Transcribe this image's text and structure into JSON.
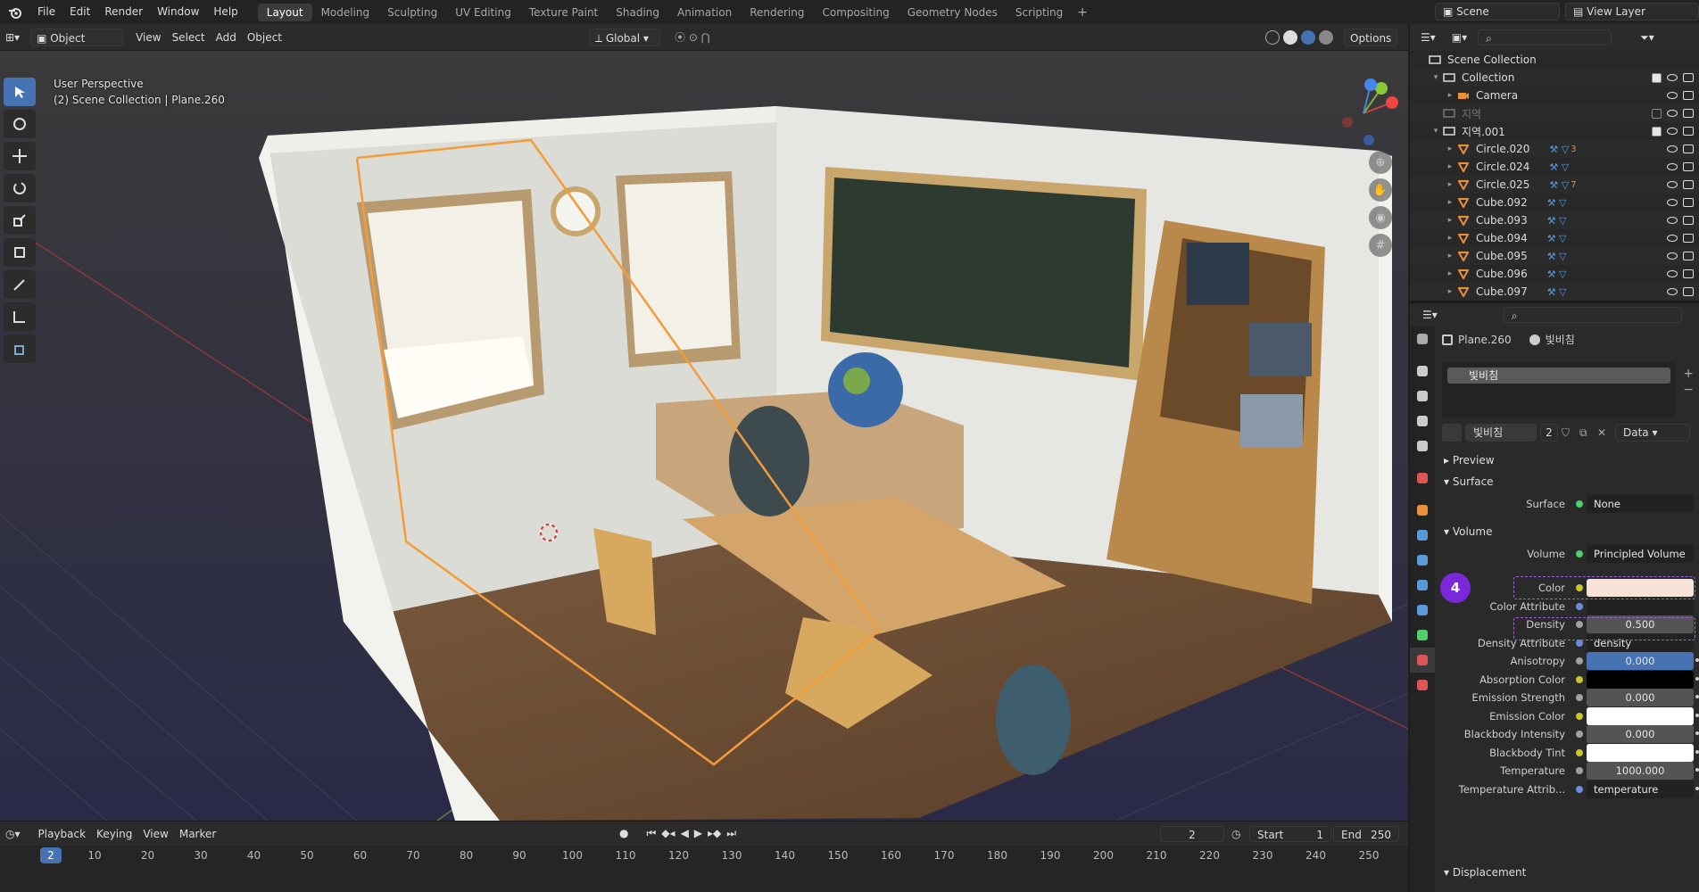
{
  "topbar": {
    "menus": [
      "File",
      "Edit",
      "Render",
      "Window",
      "Help"
    ],
    "tabs": [
      "Layout",
      "Modeling",
      "Sculpting",
      "UV Editing",
      "Texture Paint",
      "Shading",
      "Animation",
      "Rendering",
      "Compositing",
      "Geometry Nodes",
      "Scripting"
    ],
    "active_tab": "Layout",
    "scene": "Scene",
    "view_layer": "View Layer"
  },
  "viewport_header": {
    "mode": "Object Mode",
    "menus": [
      "View",
      "Select",
      "Add",
      "Object"
    ],
    "orientation": "Global",
    "options": "Options"
  },
  "viewport": {
    "perspective": "User Perspective",
    "collection_info": "(2) Scene Collection | Plane.260"
  },
  "outliner": {
    "search_placeholder": "",
    "rows": [
      {
        "name": "Scene Collection",
        "level": 0,
        "type": "collection",
        "expand": ""
      },
      {
        "name": "Collection",
        "level": 1,
        "type": "collection",
        "expand": "▾",
        "checked": true
      },
      {
        "name": "Camera",
        "level": 2,
        "type": "camera",
        "expand": "▸"
      },
      {
        "name": "지역",
        "level": 1,
        "type": "collection-dim",
        "expand": "",
        "checked": false
      },
      {
        "name": "지역.001",
        "level": 1,
        "type": "collection",
        "expand": "▾",
        "checked": true
      },
      {
        "name": "Circle.020",
        "level": 2,
        "type": "mesh",
        "expand": "▸",
        "badge": "3"
      },
      {
        "name": "Circle.024",
        "level": 2,
        "type": "mesh",
        "expand": "▸"
      },
      {
        "name": "Circle.025",
        "level": 2,
        "type": "mesh",
        "expand": "▸",
        "badge": "7"
      },
      {
        "name": "Cube.092",
        "level": 2,
        "type": "mesh",
        "expand": "▸"
      },
      {
        "name": "Cube.093",
        "level": 2,
        "type": "mesh",
        "expand": "▸"
      },
      {
        "name": "Cube.094",
        "level": 2,
        "type": "mesh",
        "expand": "▸"
      },
      {
        "name": "Cube.095",
        "level": 2,
        "type": "mesh",
        "expand": "▸"
      },
      {
        "name": "Cube.096",
        "level": 2,
        "type": "mesh",
        "expand": "▸"
      },
      {
        "name": "Cube.097",
        "level": 2,
        "type": "mesh",
        "expand": "▸"
      }
    ]
  },
  "properties": {
    "object": "Plane.260",
    "material": "빛비침",
    "slot": "빛비침",
    "users": "2",
    "link": "Data",
    "sections": {
      "preview": "Preview",
      "surface": "Surface",
      "volume": "Volume",
      "displacement": "Displacement"
    },
    "surface_label": "Surface",
    "surface_value": "None",
    "volume_label": "Volume",
    "volume_value": "Principled Volume",
    "rows": [
      {
        "label": "Color",
        "value": "",
        "kind": "color",
        "color": "#f6e3d6",
        "socket": "#c9c629"
      },
      {
        "label": "Color Attribute",
        "value": "",
        "kind": "text",
        "socket": "#6a8cd9"
      },
      {
        "label": "Density",
        "value": "0.500",
        "kind": "num",
        "socket": "#a1a1a1"
      },
      {
        "label": "Density Attribute",
        "value": "density",
        "kind": "text",
        "socket": "#6a8cd9"
      },
      {
        "label": "Anisotropy",
        "value": "0.000",
        "kind": "num-blue",
        "socket": "#a1a1a1"
      },
      {
        "label": "Absorption Color",
        "value": "",
        "kind": "color",
        "color": "#000000",
        "socket": "#c9c629"
      },
      {
        "label": "Emission Strength",
        "value": "0.000",
        "kind": "num",
        "socket": "#a1a1a1"
      },
      {
        "label": "Emission Color",
        "value": "",
        "kind": "color",
        "color": "#ffffff",
        "socket": "#c9c629"
      },
      {
        "label": "Blackbody Intensity",
        "value": "0.000",
        "kind": "num",
        "socket": "#a1a1a1"
      },
      {
        "label": "Blackbody Tint",
        "value": "",
        "kind": "color",
        "color": "#ffffff",
        "socket": "#c9c629"
      },
      {
        "label": "Temperature",
        "value": "1000.000",
        "kind": "num",
        "socket": "#a1a1a1"
      },
      {
        "label": "Temperature Attrib...",
        "value": "temperature",
        "kind": "text",
        "socket": "#6a8cd9"
      }
    ],
    "step_badge": "4"
  },
  "timeline": {
    "menus": [
      "Playback",
      "Keying",
      "View",
      "Marker"
    ],
    "current_frame": "2",
    "start_label": "Start",
    "start": "1",
    "end_label": "End",
    "end": "250",
    "ticks": [
      "10",
      "20",
      "30",
      "40",
      "50",
      "60",
      "70",
      "80",
      "90",
      "100",
      "110",
      "120",
      "130",
      "140",
      "150",
      "160",
      "170",
      "180",
      "190",
      "200",
      "210",
      "220",
      "230",
      "240",
      "250"
    ]
  }
}
